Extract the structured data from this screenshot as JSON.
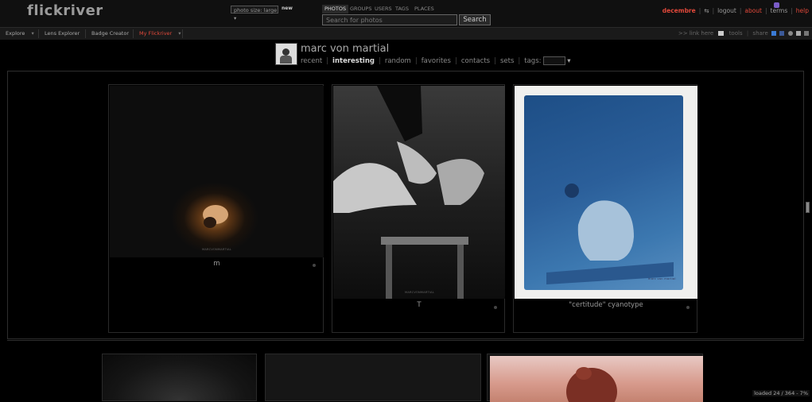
{
  "header": {
    "logo": "flickriver",
    "photo_size": "photo size: large",
    "new_badge": "new",
    "search_tabs": [
      "PHOTOS",
      "GROUPS",
      "USERS",
      "TAGS",
      "PLACES"
    ],
    "search_placeholder": "Search for photos",
    "search_button": "Search",
    "user": "decembre",
    "logout": "logout",
    "about": "about",
    "terms": "terms",
    "help": "help"
  },
  "nav": {
    "explore": "Explore",
    "lens_explorer": "Lens Explorer",
    "badge_creator": "Badge Creator",
    "my_flickriver": "My Flickriver",
    "link_here": ">> link here",
    "tools": "tools",
    "share": "share"
  },
  "profile": {
    "name": "marc von martial",
    "tabs": [
      "recent",
      "interesting",
      "random",
      "favorites",
      "contacts",
      "sets",
      "tags:"
    ],
    "active_tab": "interesting"
  },
  "photos": [
    {
      "caption": "m",
      "watermark": "MARCVONMARTIAL"
    },
    {
      "caption": "T",
      "watermark": "MARCVONMARTIAL"
    },
    {
      "caption": "\"certitude\" cyanotype",
      "watermark": "marc von martial"
    }
  ],
  "status": "loaded 24 / 364 - 7%",
  "colors": {
    "accent": "#e0483a",
    "background": "#000000",
    "cyan_print": "#2b5f9a"
  }
}
